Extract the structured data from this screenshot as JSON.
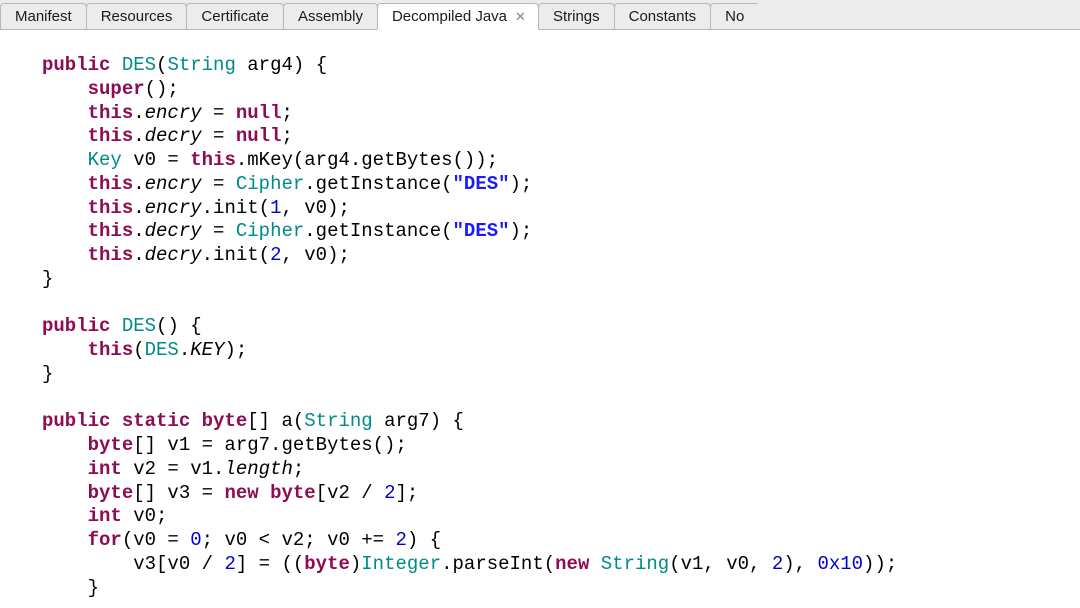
{
  "tabs": [
    {
      "label": "Manifest",
      "active": false
    },
    {
      "label": "Resources",
      "active": false
    },
    {
      "label": "Certificate",
      "active": false
    },
    {
      "label": "Assembly",
      "active": false
    },
    {
      "label": "Decompiled Java",
      "active": true
    },
    {
      "label": "Strings",
      "active": false
    },
    {
      "label": "Constants",
      "active": false
    },
    {
      "label": "No",
      "active": false
    }
  ],
  "code": {
    "l1": {
      "kw_public": "public",
      "type_des": "DES",
      "type_string": "String",
      "arg": "arg4",
      "brace": "{"
    },
    "l2": {
      "sup": "super",
      "paren": "();"
    },
    "l3": {
      "kw_this": "this",
      "dot": ".",
      "fld": "encry",
      "eq": " = ",
      "kw_null": "null",
      "semi": ";"
    },
    "l4": {
      "kw_this": "this",
      "dot": ".",
      "fld": "decry",
      "eq": " = ",
      "kw_null": "null",
      "semi": ";"
    },
    "l5": {
      "type_key": "Key",
      "var": " v0 = ",
      "kw_this": "this",
      "dot": ".",
      "mkey": "mKey(arg4.getBytes());"
    },
    "l6": {
      "kw_this": "this",
      "dot": ".",
      "fld": "encry",
      "eq": " = ",
      "cipher": "Cipher",
      "gi": ".getInstance(",
      "str": "\"DES\"",
      "end": ");"
    },
    "l7": {
      "kw_this": "this",
      "dot": ".",
      "fld": "encry",
      "call": ".init(",
      "n": "1",
      "rest": ", v0);"
    },
    "l8": {
      "kw_this": "this",
      "dot": ".",
      "fld": "decry",
      "eq": " = ",
      "cipher": "Cipher",
      "gi": ".getInstance(",
      "str": "\"DES\"",
      "end": ");"
    },
    "l9": {
      "kw_this": "this",
      "dot": ".",
      "fld": "decry",
      "call": ".init(",
      "n": "2",
      "rest": ", v0);"
    },
    "l10": {
      "brace": "}"
    },
    "l11": {
      "kw_public": "public",
      "type_des": "DES",
      "paren": "() {"
    },
    "l12": {
      "kw_this": "this",
      "open": "(",
      "des": "DES",
      "dot": ".",
      "key": "KEY",
      "end": ");"
    },
    "l13": {
      "brace": "}"
    },
    "l14": {
      "kw_public": "public",
      "kw_static": "static",
      "kw_byte": "byte",
      "brackets": "[] a(",
      "type_string": "String",
      "arg": " arg7) {"
    },
    "l15": {
      "kw_byte": "byte",
      "txt": "[] v1 = arg7.getBytes();"
    },
    "l16": {
      "kw_int": "int",
      "var": " v2 = v1.",
      "len": "length",
      "semi": ";"
    },
    "l17": {
      "kw_byte": "byte",
      "txt1": "[] v3 = ",
      "kw_new": "new",
      "sp": " ",
      "kw_byte2": "byte",
      "txt2": "[v2 / ",
      "n": "2",
      "txt3": "];"
    },
    "l18": {
      "kw_int": "int",
      "txt": " v0;"
    },
    "l19": {
      "kw_for": "for",
      "open": "(v0 = ",
      "n0": "0",
      "mid": "; v0 < v2; v0 += ",
      "n2": "2",
      "end": ") {"
    },
    "l20": {
      "txt1": "v3[v0 / ",
      "n2a": "2",
      "txt2": "] = ((",
      "kw_byte": "byte",
      "close1": ")",
      "integer": "Integer",
      "parse": ".parseInt(",
      "kw_new": "new",
      "sp": " ",
      "type_string": "String",
      "args": "(v1, v0, ",
      "n2b": "2",
      "comma": "), ",
      "hex": "0x10",
      "end": "));"
    },
    "l21": {
      "brace": "}"
    }
  }
}
